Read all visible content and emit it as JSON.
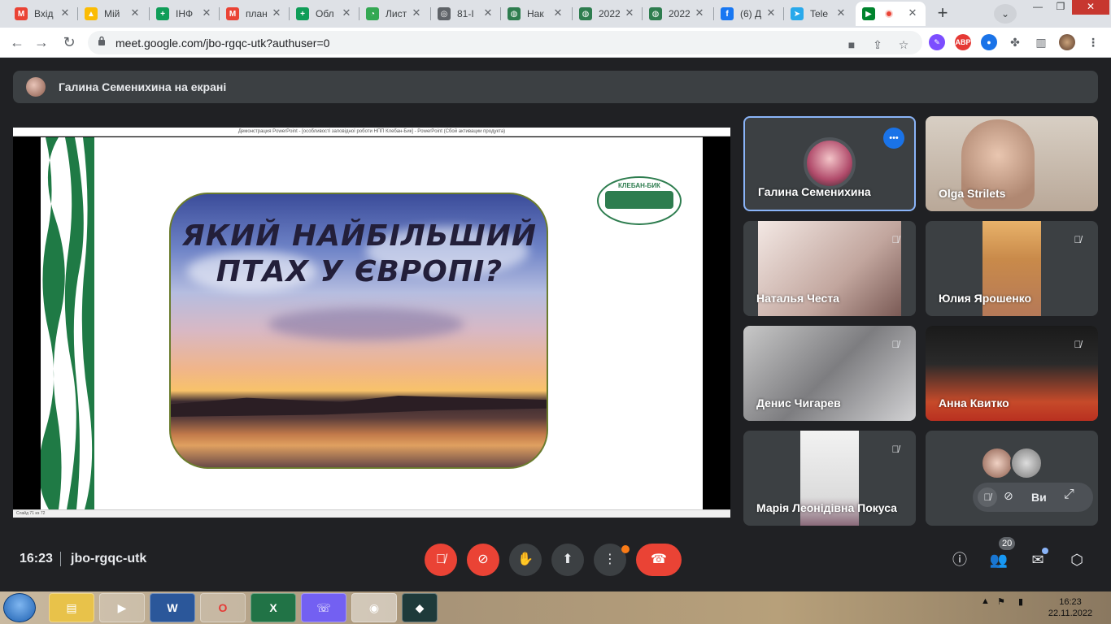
{
  "tabs": [
    {
      "title": "Вхід",
      "fav_color": "#ea4335",
      "fav_glyph": "M"
    },
    {
      "title": "Мій",
      "fav_color": "#fbbc04",
      "fav_glyph": "▲"
    },
    {
      "title": "ІНФ",
      "fav_color": "#0f9d58",
      "fav_glyph": "+"
    },
    {
      "title": "план",
      "fav_color": "#ea4335",
      "fav_glyph": "M"
    },
    {
      "title": "Обл",
      "fav_color": "#0f9d58",
      "fav_glyph": "+"
    },
    {
      "title": "Лист",
      "fav_color": "#34a853",
      "fav_glyph": "◔"
    },
    {
      "title": "81-І",
      "fav_color": "#5f6368",
      "fav_glyph": "◎"
    },
    {
      "title": "Нак",
      "fav_color": "#2e7d4f",
      "fav_glyph": "◍"
    },
    {
      "title": "2022",
      "fav_color": "#2e7d4f",
      "fav_glyph": "◍"
    },
    {
      "title": "2022",
      "fav_color": "#2e7d4f",
      "fav_glyph": "◍"
    },
    {
      "title": "(6) Д",
      "fav_color": "#1877f2",
      "fav_glyph": "f"
    },
    {
      "title": "Tele",
      "fav_color": "#29a9eb",
      "fav_glyph": "➤"
    }
  ],
  "active_tab": {
    "fav_color": "#00832d",
    "recording_color": "#ea4335"
  },
  "address": {
    "url": "meet.google.com/jbo-rgqc-utk?authuser=0"
  },
  "extensions": [
    {
      "name": "abp",
      "label": "ABP",
      "color": "#e53935"
    }
  ],
  "presenting": {
    "text": "Галина Семенихина на екрані"
  },
  "ppt": {
    "title_bar": "Демонстрация PowerPoint - [особливості заповідної роботи НПП Клебан-Бик] - PowerPoint (Сбой активации продукта)",
    "status": "Слайд 71 из 72"
  },
  "slide": {
    "question_line1": "ЯКИЙ НАЙБІЛЬШИЙ",
    "question_line2": "ПТАХ У ЄВРОПІ?",
    "logo_text": "КЛЕБАН-БИК",
    "logo_sub": "РЕГІОНАЛЬНИЙ ЛАНДШАФТНИЙ ПАРК"
  },
  "participants": [
    {
      "name": "Галина Семенихина",
      "speaking": true
    },
    {
      "name": "Olga Strilets",
      "muted": false
    },
    {
      "name": "Наталья Честа",
      "muted": true
    },
    {
      "name": "Юлия Ярошенко",
      "muted": true
    },
    {
      "name": "Денис Чигарев",
      "muted": true
    },
    {
      "name": "Анна Квитко",
      "muted": true
    },
    {
      "name": "Марія Леонідівна Покуса",
      "muted": true
    }
  ],
  "self_tile": {
    "label": "Ви"
  },
  "bottom": {
    "time": "16:23",
    "meeting_code": "jbo-rgqc-utk",
    "participants_count": "20"
  },
  "taskbar": {
    "clock_time": "16:23",
    "clock_date": "22.11.2022"
  }
}
